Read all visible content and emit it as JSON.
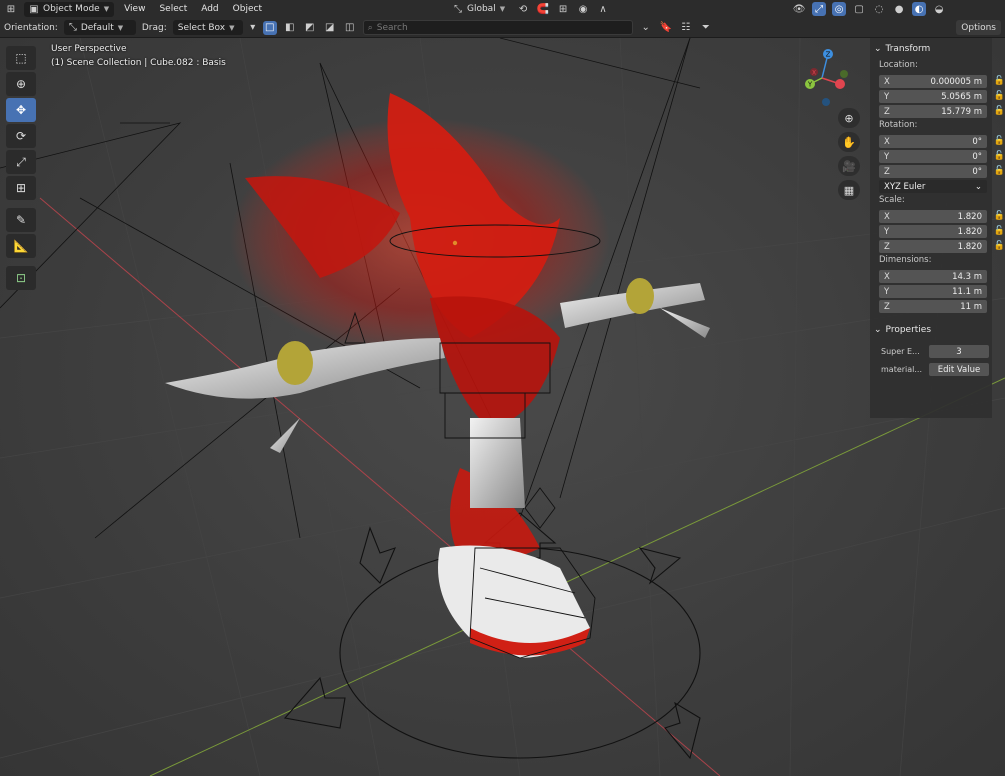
{
  "header": {
    "mode": "Object Mode",
    "menus": [
      "View",
      "Select",
      "Add",
      "Object"
    ],
    "transform_orientation": "Global",
    "options_label": "Options"
  },
  "toolsettings": {
    "orientation_label": "Orientation:",
    "orientation_value": "Default",
    "drag_label": "Drag:",
    "drag_value": "Select Box",
    "search_placeholder": "Search"
  },
  "viewport": {
    "perspective": "User Perspective",
    "collection_info": "(1) Scene Collection | Cube.082 : Basis"
  },
  "gizmo": {
    "x": "X",
    "y": "Y",
    "z": "Z"
  },
  "npanel": {
    "transform_title": "Transform",
    "location_label": "Location:",
    "location": [
      {
        "axis": "X",
        "value": "0.000005 m"
      },
      {
        "axis": "Y",
        "value": "5.0565 m"
      },
      {
        "axis": "Z",
        "value": "15.779 m"
      }
    ],
    "rotation_label": "Rotation:",
    "rotation": [
      {
        "axis": "X",
        "value": "0°"
      },
      {
        "axis": "Y",
        "value": "0°"
      },
      {
        "axis": "Z",
        "value": "0°"
      }
    ],
    "rotation_mode": "XYZ Euler",
    "scale_label": "Scale:",
    "scale": [
      {
        "axis": "X",
        "value": "1.820"
      },
      {
        "axis": "Y",
        "value": "1.820"
      },
      {
        "axis": "Z",
        "value": "1.820"
      }
    ],
    "dimensions_label": "Dimensions:",
    "dimensions": [
      {
        "axis": "X",
        "value": "14.3 m"
      },
      {
        "axis": "Y",
        "value": "11.1 m"
      },
      {
        "axis": "Z",
        "value": "11 m"
      }
    ],
    "properties_title": "Properties",
    "properties": [
      {
        "label": "Super E...",
        "value": "3"
      },
      {
        "label": "material...",
        "value": "Edit Value"
      }
    ]
  },
  "colors": {
    "accent": "#4772b3",
    "axis_x": "#e0454f",
    "axis_y": "#8bc53f",
    "axis_z": "#3d8fe0",
    "model_glow": "#ff2a1a"
  }
}
